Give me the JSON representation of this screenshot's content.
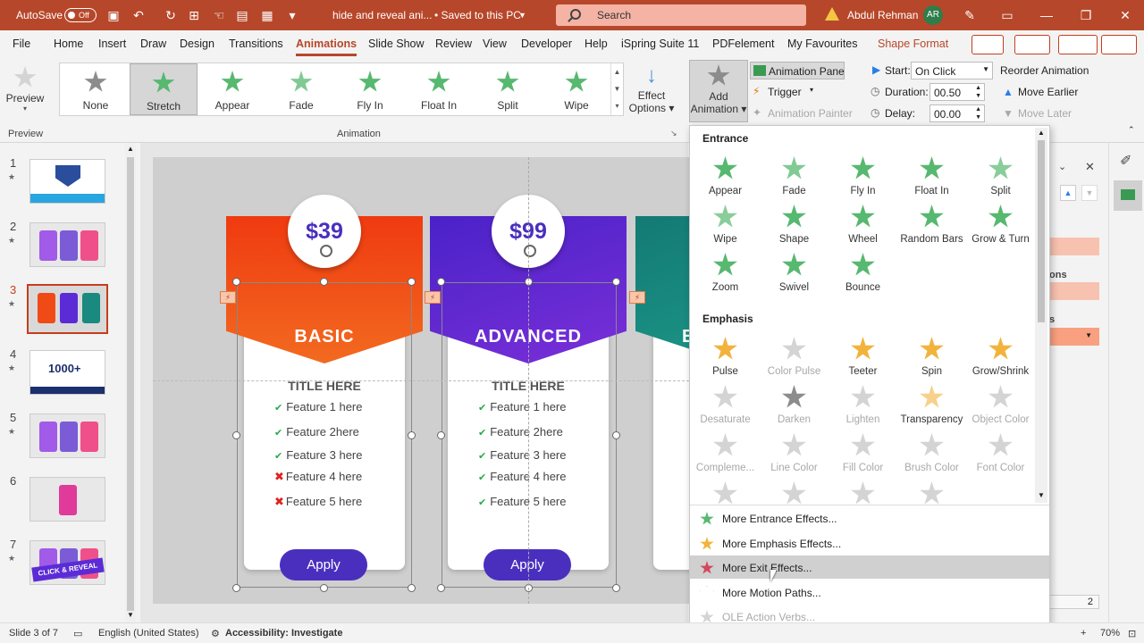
{
  "titlebar": {
    "autosave_label": "AutoSave",
    "autosave_state": "Off",
    "filename": "hide and reveal ani...",
    "save_status": "• Saved to this PC",
    "search_placeholder": "Search",
    "user_name": "Abdul Rehman",
    "user_initials": "AR",
    "accent_color": "#b7472a"
  },
  "menu": {
    "tabs": [
      "File",
      "Home",
      "Insert",
      "Draw",
      "Design",
      "Transitions",
      "Animations",
      "Slide Show",
      "Review",
      "View",
      "Developer",
      "Help",
      "iSpring Suite 11",
      "PDFelement",
      "My Favourites",
      "Shape Format"
    ],
    "active_tab": "Animations"
  },
  "ribbon": {
    "preview_label": "Preview",
    "preview_group": "Preview",
    "animation_group": "Animation",
    "gallery": [
      "None",
      "Stretch",
      "Appear",
      "Fade",
      "Fly In",
      "Float In",
      "Split",
      "Wipe"
    ],
    "selected_gallery": "Stretch",
    "effect_options_label_1": "Effect",
    "effect_options_label_2": "Options",
    "add_animation_label_1": "Add",
    "add_animation_label_2": "Animation",
    "animation_pane_label": "Animation Pane",
    "trigger_label": "Trigger",
    "animation_painter_label": "Animation Painter",
    "start_label": "Start:",
    "start_value": "On Click",
    "duration_label": "Duration:",
    "duration_value": "00.50",
    "delay_label": "Delay:",
    "delay_value": "00.00",
    "reorder_label": "Reorder Animation",
    "move_earlier_label": "Move Earlier",
    "move_later_label": "Move Later"
  },
  "slides": {
    "numbers": [
      "1",
      "2",
      "3",
      "4",
      "5",
      "6",
      "7"
    ],
    "selected": "3",
    "thumb4_text": "1000+",
    "thumb7_text": "CLICK & REVEAL"
  },
  "pricing": {
    "cards": [
      {
        "price": "$39",
        "title": "BASIC",
        "subtitle": "TITLE HERE",
        "button": "Apply",
        "color": "#f04a16"
      },
      {
        "price": "$99",
        "title": "ADVANCED",
        "subtitle": "TITLE HERE",
        "button": "Apply",
        "color": "#5b2bd6"
      },
      {
        "title": "E",
        "color": "#1a8a80"
      }
    ],
    "card1_features": [
      {
        "text": "Feature 1 here",
        "mark": "check"
      },
      {
        "text": "Feature 2here",
        "mark": "check"
      },
      {
        "text": "Feature 3 here",
        "mark": "check"
      },
      {
        "text": "Feature 4 here",
        "mark": "cross"
      },
      {
        "text": "Feature 5 here",
        "mark": "cross"
      }
    ],
    "card2_features": [
      {
        "text": "Feature 1 here",
        "mark": "check"
      },
      {
        "text": "Feature 2here",
        "mark": "check"
      },
      {
        "text": "Feature 3 here",
        "mark": "check"
      },
      {
        "text": "Feature 4 here",
        "mark": "check"
      },
      {
        "text": "Feature 5 here",
        "mark": "check"
      }
    ]
  },
  "dropdown": {
    "entrance_title": "Entrance",
    "entrance": [
      "Appear",
      "Fade",
      "Fly In",
      "Float In",
      "Split",
      "Wipe",
      "Shape",
      "Wheel",
      "Random Bars",
      "Grow & Turn",
      "Zoom",
      "Swivel",
      "Bounce"
    ],
    "emphasis_title": "Emphasis",
    "emphasis": [
      {
        "label": "Pulse",
        "enabled": true
      },
      {
        "label": "Color Pulse",
        "enabled": false
      },
      {
        "label": "Teeter",
        "enabled": true
      },
      {
        "label": "Spin",
        "enabled": true
      },
      {
        "label": "Grow/Shrink",
        "enabled": true
      },
      {
        "label": "Desaturate",
        "enabled": false
      },
      {
        "label": "Darken",
        "enabled": false
      },
      {
        "label": "Lighten",
        "enabled": false
      },
      {
        "label": "Transparency",
        "enabled": true
      },
      {
        "label": "Object Color",
        "enabled": false
      },
      {
        "label": "Compleme...",
        "enabled": false
      },
      {
        "label": "Line Color",
        "enabled": false
      },
      {
        "label": "Fill Color",
        "enabled": false
      },
      {
        "label": "Brush Color",
        "enabled": false
      },
      {
        "label": "Font Color",
        "enabled": false
      }
    ],
    "more_entrance": "More Entrance Effects...",
    "more_emphasis": "More Emphasis Effects...",
    "more_exit": "More Exit Effects...",
    "more_motion": "More Motion Paths...",
    "ole_verbs": "OLE Action Verbs..."
  },
  "rightpane": {
    "partial_text_1": "ons",
    "partial_text_2": "s",
    "page_value": "2"
  },
  "status": {
    "slide_info": "Slide 3 of 7",
    "language": "English (United States)",
    "accessibility": "Accessibility: Investigate",
    "zoom": "70%"
  }
}
